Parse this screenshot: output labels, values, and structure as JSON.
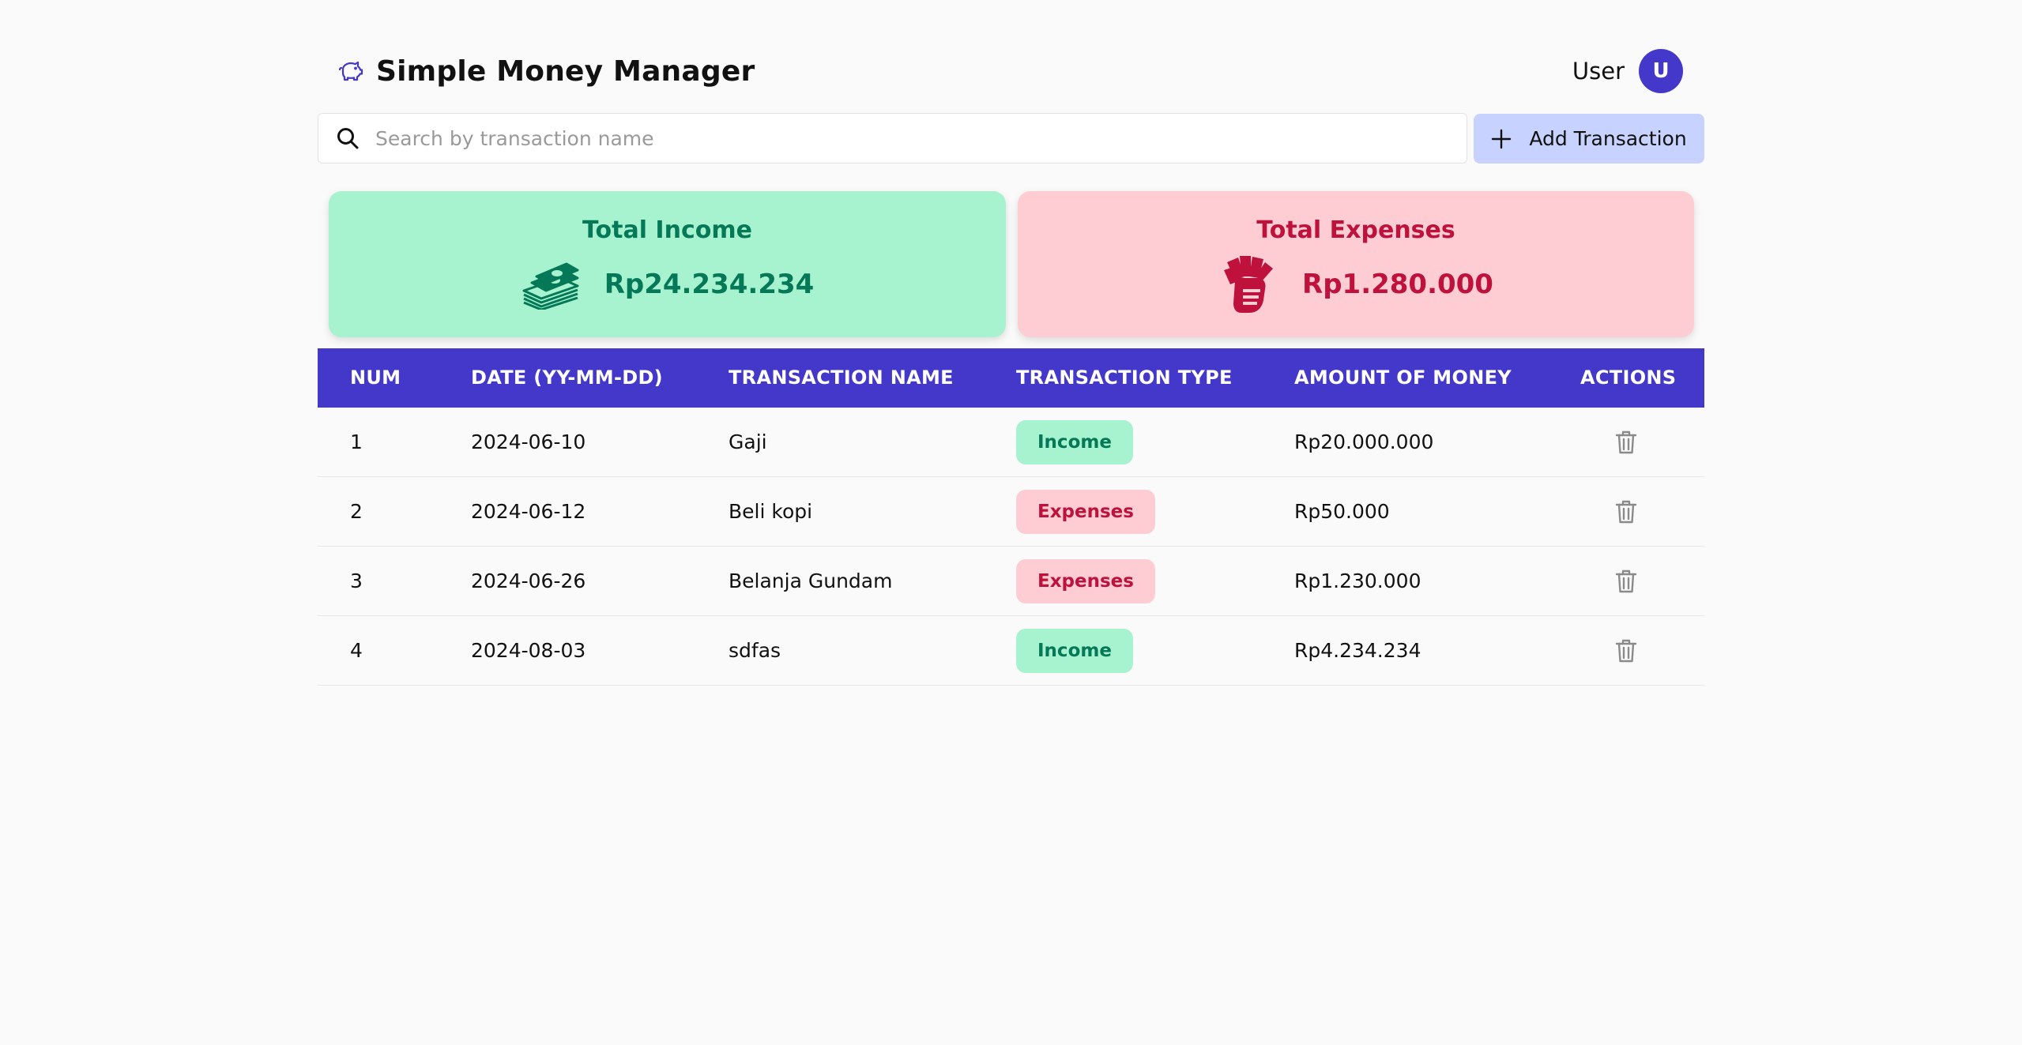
{
  "header": {
    "title": "Simple Money Manager",
    "user_name": "User",
    "avatar_initial": "U"
  },
  "search": {
    "placeholder": "Search by transaction name",
    "value": ""
  },
  "add_button_label": "Add Transaction",
  "summary": {
    "income": {
      "title": "Total Income",
      "amount": "Rp24.234.234",
      "icon": "money-stack-icon"
    },
    "expenses": {
      "title": "Total Expenses",
      "amount": "Rp1.280.000",
      "icon": "money-hand-icon"
    }
  },
  "table": {
    "headers": {
      "num": "NUM",
      "date": "DATE (YY-MM-DD)",
      "name": "TRANSACTION NAME",
      "type": "TRANSACTION TYPE",
      "amount": "AMOUNT OF MONEY",
      "actions": "ACTIONS"
    },
    "rows": [
      {
        "num": "1",
        "date": "2024-06-10",
        "name": "Gaji",
        "type": "Income",
        "amount": "Rp20.000.000"
      },
      {
        "num": "2",
        "date": "2024-06-12",
        "name": "Beli kopi",
        "type": "Expenses",
        "amount": "Rp50.000"
      },
      {
        "num": "3",
        "date": "2024-06-26",
        "name": "Belanja Gundam",
        "type": "Expenses",
        "amount": "Rp1.230.000"
      },
      {
        "num": "4",
        "date": "2024-08-03",
        "name": "sdfas",
        "type": "Income",
        "amount": "Rp4.234.234"
      }
    ]
  },
  "colors": {
    "accent": "#4338ca",
    "income_bg": "#a7f3d0",
    "income_text": "#047857",
    "expense_bg": "#fecdd3",
    "expense_text": "#be123c",
    "add_button_bg": "#c7d2fe"
  }
}
